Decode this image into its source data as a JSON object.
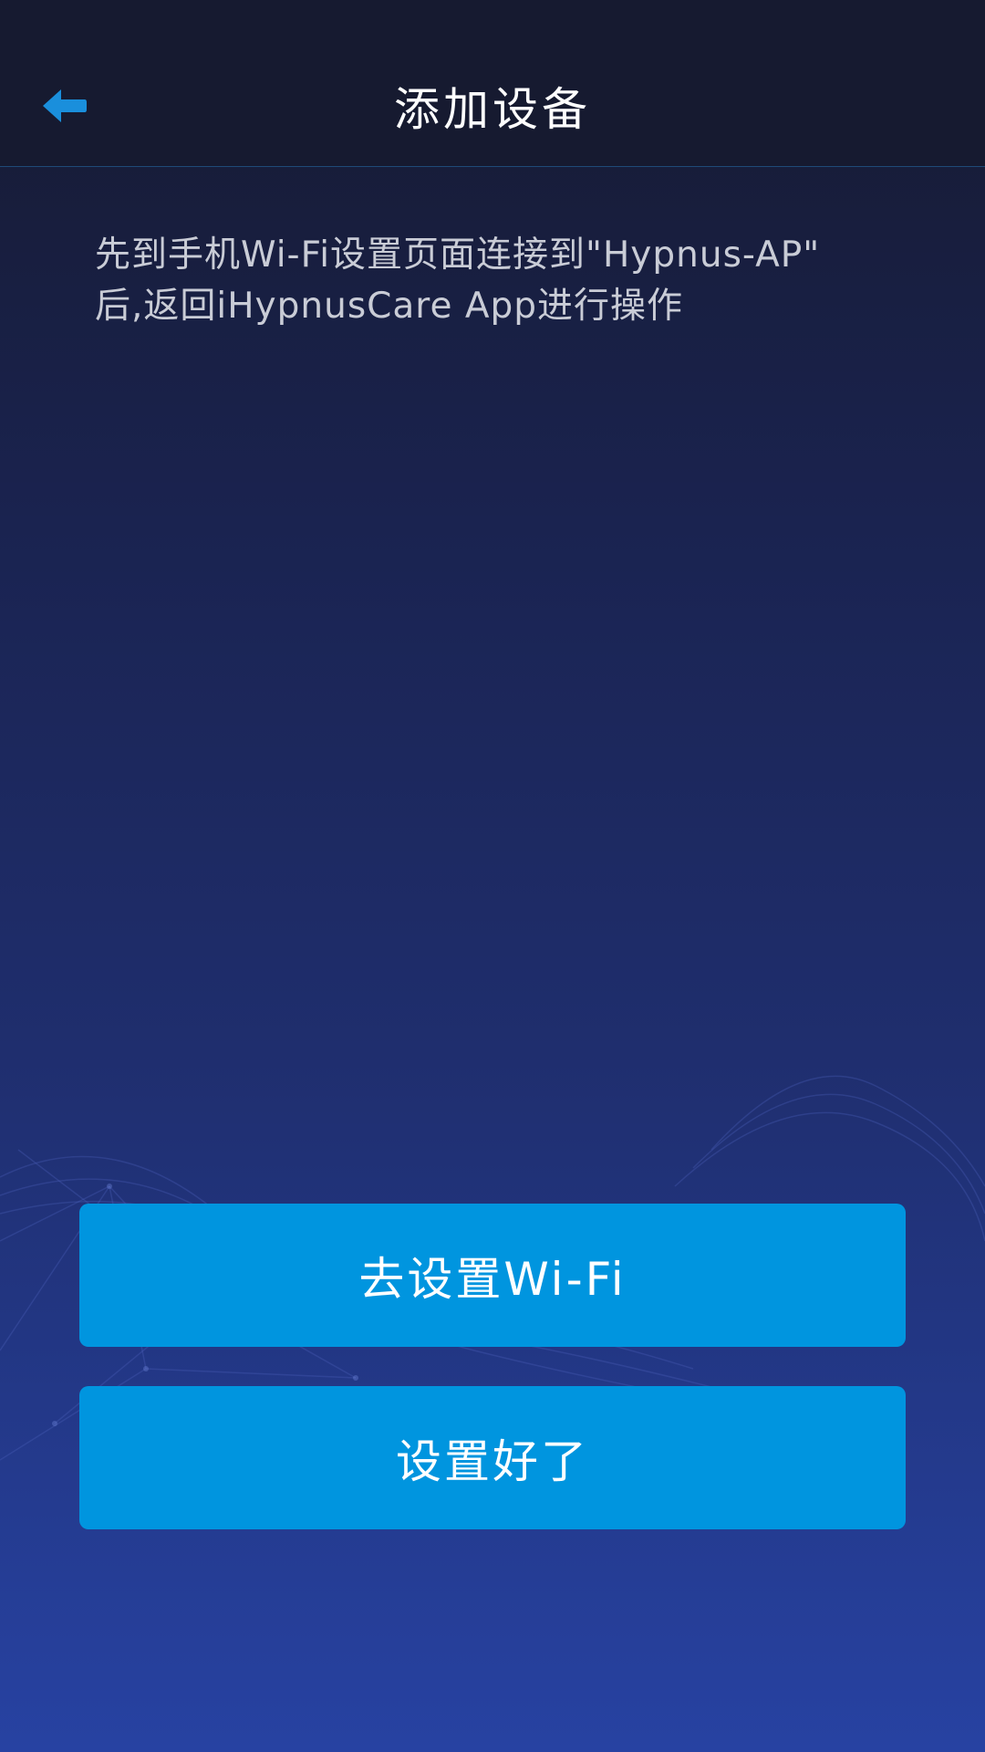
{
  "header": {
    "title": "添加设备",
    "back_icon": "back-arrow-icon"
  },
  "instruction": {
    "line1": "先到手机Wi-Fi设置页面连接到\"Hypnus-AP\"",
    "line2": "后,返回iHypnusCare App进行操作"
  },
  "buttons": {
    "go_wifi_label": "去设置Wi-Fi",
    "done_label": "设置好了"
  },
  "colors": {
    "accent": "#0095df",
    "header_bg": "#161a30",
    "bg_bottom": "#2742a2",
    "back_icon": "#1a8fdc"
  }
}
